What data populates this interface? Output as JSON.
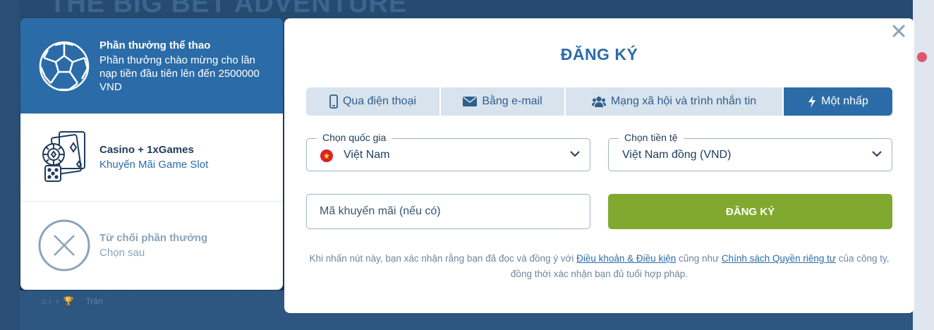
{
  "background": {
    "title": "THE BIG BET ADVENTURE",
    "breadcrumb": "Trận"
  },
  "bonuses": [
    {
      "icon": "soccer-ball-icon",
      "title": "Phần thưởng thể thao",
      "desc": "Phần thưởng chào mừng cho lần nạp tiền đầu tiên lên đến 2500000 VND",
      "active": true
    },
    {
      "icon": "casino-chips-cards-icon",
      "title": "Casino + 1xGames",
      "desc": "Khuyến Mãi Game Slot",
      "active": false
    },
    {
      "icon": "decline-x-icon",
      "title": "Từ chối phần thưởng",
      "desc": "Chọn sau",
      "active": false
    }
  ],
  "modal": {
    "title": "ĐĂNG KÝ",
    "tabs": [
      {
        "icon": "phone-icon",
        "label": "Qua điện thoại"
      },
      {
        "icon": "envelope-icon",
        "label": "Bằng e-mail"
      },
      {
        "icon": "users-icon",
        "label": "Mạng xã hội và trình nhắn tin"
      },
      {
        "icon": "lightning-icon",
        "label": "Một nhấp",
        "active": true
      }
    ],
    "country": {
      "legend": "Chọn quốc gia",
      "value": "Việt Nam"
    },
    "currency": {
      "legend": "Chọn tiền tệ",
      "value": "Việt Nam đồng (VND)"
    },
    "promo": {
      "placeholder": "Mã khuyến mãi (nếu có)"
    },
    "register_label": "ĐĂNG KÝ",
    "legal": {
      "before": "Khi nhấn nút này, bạn xác nhận rằng bạn đã đọc và đồng ý với ",
      "terms_link": "Điều khoản & Điều kiện",
      "middle": " cũng như ",
      "privacy_link": "Chính sách Quyền riêng tư",
      "after": " của công ty, đồng thời xác nhận bạn đủ tuổi hợp pháp."
    }
  },
  "colors": {
    "primary": "#2b6ca8",
    "accent_green": "#81a92f",
    "overlay": "#1f3d5e"
  }
}
